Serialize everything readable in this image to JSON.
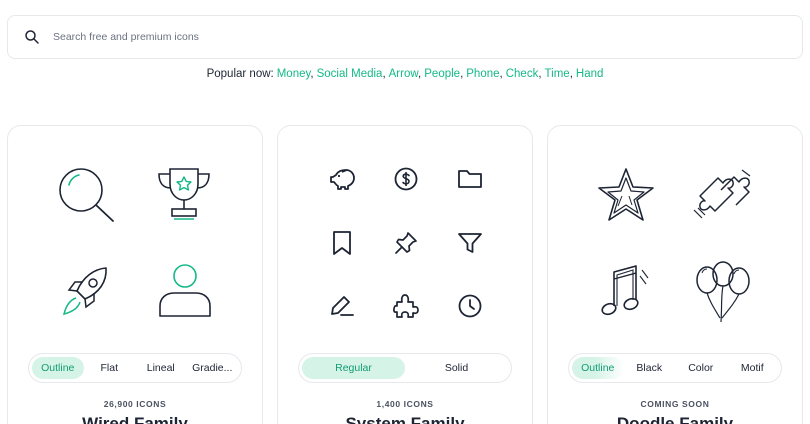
{
  "search": {
    "placeholder": "Search free and premium icons",
    "value": ""
  },
  "popular": {
    "label": "Popular now:",
    "links": [
      "Money",
      "Social Media",
      "Arrow",
      "People",
      "Phone",
      "Check",
      "Time",
      "Hand"
    ],
    "link_color": "#15b887"
  },
  "cards": [
    {
      "tabs": [
        "Outline",
        "Flat",
        "Lineal",
        "Gradie..."
      ],
      "active_tab": "Outline",
      "count": "26,900 ICONS",
      "family": "Wired Family",
      "icons": [
        "magnifier-icon",
        "trophy-icon",
        "rocket-icon",
        "user-icon"
      ]
    },
    {
      "tabs": [
        "Regular",
        "Solid"
      ],
      "active_tab": "Regular",
      "count": "1,400 ICONS",
      "family": "System Family",
      "icons": [
        "piggy-bank-icon",
        "dollar-coin-icon",
        "folder-icon",
        "bookmark-icon",
        "pin-icon",
        "filter-icon",
        "edit-icon",
        "puzzle-icon",
        "clock-icon"
      ]
    },
    {
      "tabs": [
        "Outline",
        "Black",
        "Color",
        "Motif"
      ],
      "active_tab": "Outline",
      "count": "COMING SOON",
      "family": "Doodle Family",
      "icons": [
        "star-doodle-icon",
        "puzzle-doodle-icon",
        "music-note-doodle-icon",
        "balloons-doodle-icon"
      ]
    }
  ],
  "colors": {
    "accent": "#15b887",
    "accent_bg": "#d6f3e8",
    "ink": "#1d2433",
    "border": "#e6e8ec"
  }
}
